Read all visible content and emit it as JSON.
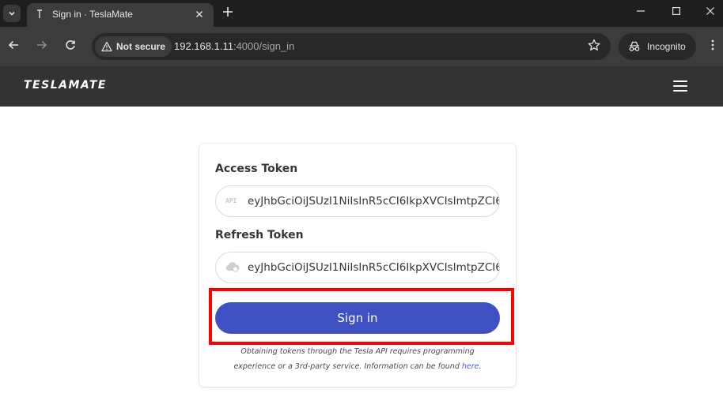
{
  "browser": {
    "tab_title": "Sign in · TeslaMate",
    "security_label": "Not secure",
    "url_host": "192.168.1.11",
    "url_path": ":4000/sign_in",
    "incognito_label": "Incognito"
  },
  "app": {
    "brand": "TESLAMATE"
  },
  "form": {
    "access_token_label": "Access Token",
    "access_token_icon_text": "API",
    "access_token_value": "eyJhbGciOiJSUzI1NiIsInR5cCI6IkpXVCIsImtpZCI6",
    "refresh_token_label": "Refresh Token",
    "refresh_token_value": "eyJhbGciOiJSUzI1NiIsInR5cCI6IkpXVCIsImtpZCI6",
    "submit_label": "Sign in",
    "help_text_line1": "Obtaining tokens through the Tesla API requires programming",
    "help_text_line2": "experience or a 3rd-party service. Information can be found",
    "help_link": "here",
    "help_period": "."
  },
  "colors": {
    "primary": "#3f51c2",
    "highlight": "#ff0000",
    "navbar": "#333333"
  }
}
